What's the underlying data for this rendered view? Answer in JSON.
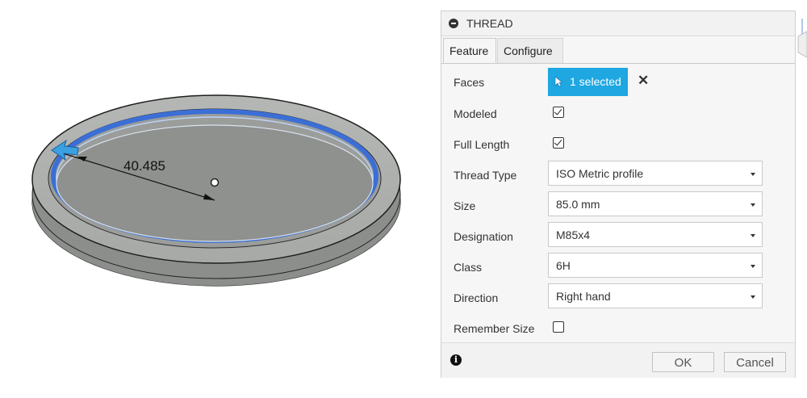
{
  "viewport": {
    "dimension_value": "40.485"
  },
  "panel": {
    "title": "THREAD",
    "tabs": [
      {
        "label": "Feature",
        "active": true
      },
      {
        "label": "Configure",
        "active": false
      }
    ],
    "fields": {
      "faces": {
        "label": "Faces",
        "value": "1 selected"
      },
      "modeled": {
        "label": "Modeled",
        "checked": true
      },
      "full_length": {
        "label": "Full Length",
        "checked": true
      },
      "thread_type": {
        "label": "Thread Type",
        "value": "ISO Metric profile"
      },
      "size": {
        "label": "Size",
        "value": "85.0 mm"
      },
      "designation": {
        "label": "Designation",
        "value": "M85x4"
      },
      "class": {
        "label": "Class",
        "value": "6H"
      },
      "direction": {
        "label": "Direction",
        "value": "Right hand"
      },
      "remember_size": {
        "label": "Remember Size",
        "checked": false
      }
    },
    "footer": {
      "ok_label": "OK",
      "cancel_label": "Cancel"
    }
  },
  "colors": {
    "accent": "#1ea7e1",
    "thread_highlight": "#3b6fd6",
    "part_gray": "#8f918f"
  }
}
